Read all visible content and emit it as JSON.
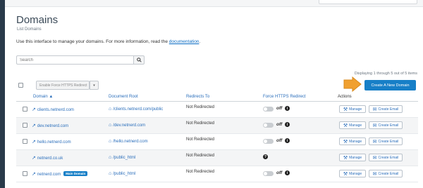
{
  "page": {
    "title": "Domains",
    "breadcrumb": "List Domains",
    "intro_text": "Use this interface to manage your domains. For more information, read the ",
    "intro_link": "documentation",
    "intro_suffix": "."
  },
  "search": {
    "placeholder": "Search",
    "value": "",
    "button_icon": "search-icon"
  },
  "pagination": {
    "summary": "Displaying 1 through 5 out of 5 items"
  },
  "bulk": {
    "action_label": "Enable Force HTTPS Redirect",
    "caret": "▾"
  },
  "create_button": {
    "label": "Create A New Domain"
  },
  "columns": {
    "domain": "Domain",
    "domain_sort": "▲",
    "docroot": "Document Root",
    "redirects": "Redirects To",
    "https": "Force HTTPS Redirect",
    "actions": "Actions"
  },
  "rows": [
    {
      "domain": "clients.netnerd.com",
      "docroot": "/clients.netnerd.com/public",
      "redirect": "Not Redirected",
      "https": "off",
      "has_checkbox": true
    },
    {
      "domain": "dev.netnerd.com",
      "docroot": "/dev.netnerd.com",
      "redirect": "Not Redirected",
      "https": "off",
      "has_checkbox": true
    },
    {
      "domain": "hello.netnerd.com",
      "docroot": "/hello.netnerd.com",
      "redirect": "Not Redirected",
      "https": "off",
      "has_checkbox": true
    },
    {
      "domain": "netnerd.co.uk",
      "docroot": "/public_html",
      "redirect": "Not Redirected",
      "https": "unknown",
      "has_checkbox": false
    },
    {
      "domain": "netnerd.com",
      "badge": "Main Domain",
      "docroot": "/public_html",
      "redirect": "Not Redirected",
      "https": "off",
      "has_checkbox": true
    }
  ],
  "actions": {
    "manage": "Manage",
    "create_email": "Create Email"
  },
  "icons": {
    "external": "external-link-icon",
    "home": "home-icon",
    "wrench": "wrench-icon",
    "envelope": "envelope-icon",
    "info": "info-icon",
    "question": "question-icon"
  },
  "colors": {
    "accent": "#177fc7",
    "link": "#2a6ebb",
    "sidebar": "#293a4a",
    "pointer": "#f0a030"
  }
}
